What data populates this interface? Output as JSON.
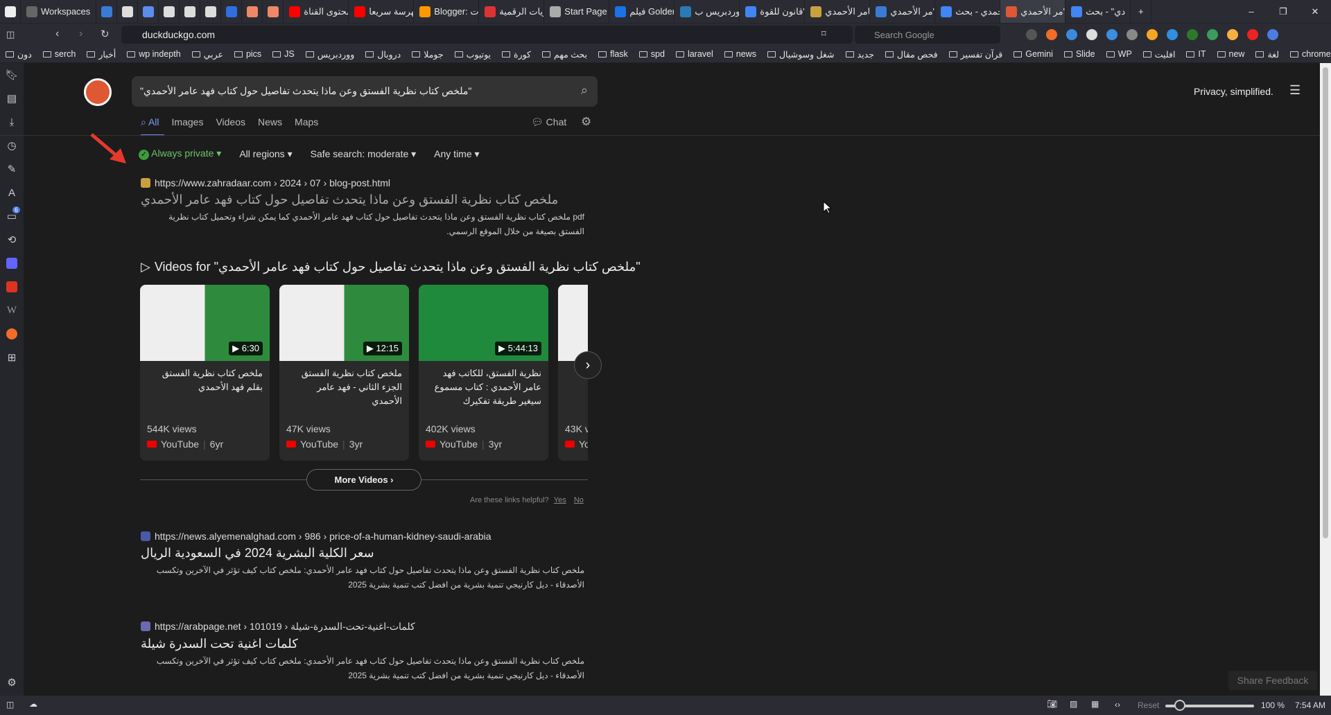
{
  "browser": {
    "tabs": [
      {
        "label": "Workspaces",
        "color": "#666"
      },
      {
        "label": "",
        "color": "#3a7bd5"
      },
      {
        "label": "",
        "color": "#ddd"
      },
      {
        "label": "",
        "color": "#5b8def"
      },
      {
        "label": "",
        "color": "#ddd"
      },
      {
        "label": "",
        "color": "#ddd"
      },
      {
        "label": "",
        "color": "#ddd"
      },
      {
        "label": "",
        "color": "#2f6fe0"
      },
      {
        "label": "",
        "color": "#e86"
      },
      {
        "label": "",
        "color": "#e86"
      },
      {
        "label": "محتوى القناة",
        "color": "#f00"
      },
      {
        "label": "فهرسة سريعا",
        "color": "#f00"
      },
      {
        "label": "Blogger: ات",
        "color": "#f90"
      },
      {
        "label": "ريات الرقمية",
        "color": "#d33"
      },
      {
        "label": "Start Page",
        "color": "#aaa"
      },
      {
        "label": "فيلم Golden",
        "color": "#1a73e8"
      },
      {
        "label": "ووردبريس ب",
        "color": "#2a7ab8"
      },
      {
        "label": "قانون للقوة\"",
        "color": "#4285f4"
      },
      {
        "label": "عامر الأحمدي",
        "color": "#c9a040"
      },
      {
        "label": "مر الأحمدي\"",
        "color": "#3a7bd5"
      },
      {
        "label": "حمدي - بحث",
        "color": "#4285f4"
      },
      {
        "label": "مر الأحمدي\"",
        "color": "#de5833"
      },
      {
        "label": "دي\" - بحث",
        "color": "#4285f4"
      }
    ],
    "url": "duckduckgo.com",
    "search_placeholder": "Search Google",
    "bookmarks": [
      "دون",
      "serch",
      "أخبار",
      "wp indepth",
      "عربي",
      "pics",
      "JS",
      "ووردبريس",
      "دروبال",
      "جوملا",
      "يوتيوب",
      "كورة",
      "بحث مهم",
      "flask",
      "spd",
      "laravel",
      "news",
      "شغل وسوشيال",
      "جديد",
      "فحص مقال",
      "قرآن تفسير",
      "Gemini",
      "Slide",
      "WP",
      "افليت",
      "IT",
      "new",
      "لغة",
      "chrome"
    ],
    "sidebar_badge": "6"
  },
  "ddg": {
    "query": "\"ملخص كتاب نظرية الفستق وعن ماذا يتحدث تفاصيل حول كتاب فهد عامر الأحمدي\"",
    "tabs": [
      "All",
      "Images",
      "Videos",
      "News",
      "Maps"
    ],
    "chat": "Chat",
    "tagline": "Privacy, simplified.",
    "filters": {
      "private": "Always private",
      "region": "All regions",
      "safe": "Safe search: moderate",
      "time": "Any time"
    },
    "results": [
      {
        "url": "https://www.zahradaar.com › 2024 › 07 › blog-post.html",
        "title": "ملخص كتاب نظرية الفستق وعن ماذا يتحدث تفاصيل حول كتاب فهد عامر الأحمدي",
        "snippet_bold": "ملخص كتاب نظرية الفستق وعن ماذا يتحدث تفاصيل حول كتاب فهد عامر الأحمدي",
        "snippet": "pdf ملخص كتاب نظرية الفستق وعن ماذا يتحدث تفاصيل حول كتاب فهد عامر الأحمدي كما يمكن شراء وتحميل كتاب نظرية الفستق بصيغة من خلال الموقع الرسمي.",
        "fav": "#c9a040"
      },
      {
        "url": "https://news.alyemenalghad.com › 986 › price-of-a-human-kidney-saudi-arabia",
        "title": "سعر الكلية البشرية 2024 في السعودية الريال",
        "snippet": "ملخص كتاب نظرية الفستق وعن ماذا يتحدث تفاصيل حول كتاب فهد عامر الأحمدي: ملخص كتاب كيف تؤثر في الآخرين وتكسب الأصدقاء - ديل كارنيجي تنمية بشرية من افضل كتب تنمية بشرية 2025",
        "fav": "#4a5aa8"
      },
      {
        "url": "https://arabpage.net › 101019 › كلمات-اغنية-تحت-السدرة-شيلة",
        "title": "كلمات اغنية تحت السدرة شيلة",
        "snippet": "ملخص كتاب نظرية الفستق وعن ماذا يتحدث تفاصيل حول كتاب فهد عامر الأحمدي: ملخص كتاب كيف تؤثر في الآخرين وتكسب الأصدقاء - ديل كارنيجي تنمية بشرية من افضل كتب تنمية بشرية 2025",
        "fav": "#6a6ab0"
      }
    ],
    "videos_header": "Videos for \"ملخص كتاب نظرية الفستق وعن ماذا يتحدث تفاصيل حول كتاب فهد عامر الأحمدي\"",
    "videos": [
      {
        "title": "ملخص كتاب نظرية الفستق بقلم فهد الأحمدي",
        "duration": "6:30",
        "views": "544K views",
        "source": "YouTube",
        "age": "6yr"
      },
      {
        "title": "ملخص كتاب نظرية الفستق الجزء الثاني - فهد عامر الأحمدي",
        "duration": "12:15",
        "views": "47K views",
        "source": "YouTube",
        "age": "3yr"
      },
      {
        "title": "نظرية الفستق، للكاتب فهد عامر الأحمدي : كتاب مسموع سيغير طريقة تفكيرك",
        "duration": "5:44:13",
        "views": "402K views",
        "source": "YouTube",
        "age": "3yr"
      },
      {
        "title": "ق ... ر فهد أحمدي",
        "duration": "",
        "views": "43K v",
        "source": "Yo",
        "age": ""
      }
    ],
    "more_videos": "More Videos",
    "helpful": "Are these links helpful?",
    "yes": "Yes",
    "no": "No",
    "feedback": "Share Feedback"
  },
  "status": {
    "reset": "Reset",
    "zoom": "100 %",
    "time": "7:54 AM",
    "zoom_fraction": 0.1
  }
}
